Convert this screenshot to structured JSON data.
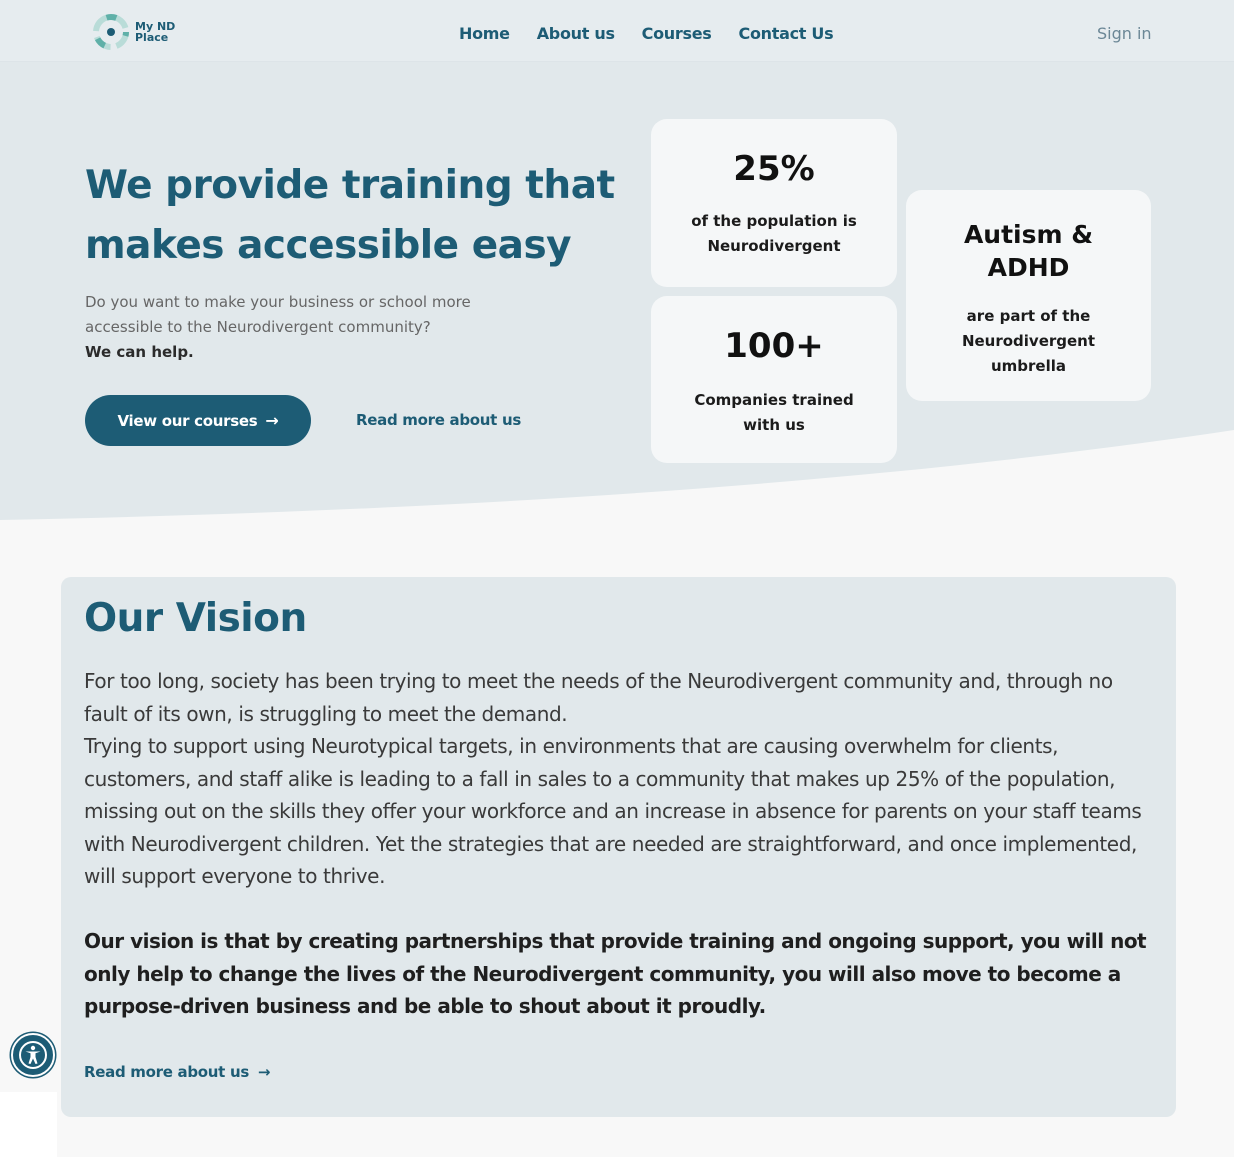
{
  "header": {
    "logo_line1": "My ND",
    "logo_line2": "Place",
    "nav": [
      "Home",
      "About us",
      "Courses",
      "Contact Us"
    ],
    "signin": "Sign in"
  },
  "hero": {
    "title_line1": "We provide training that",
    "title_line2": "makes accessible easy",
    "desc_line1": "Do you want to make your business or school more",
    "desc_line2": "accessible to the Neurodivergent community?",
    "desc_bold": "We can help.",
    "cta_label": "View our courses",
    "link_label": "Read more about us"
  },
  "stats": [
    {
      "value": "25%",
      "line1": "of the population is",
      "line2": "Neurodivergent"
    },
    {
      "value": "100+",
      "line1": "Companies trained",
      "line2": "with us"
    },
    {
      "value_line1": "Autism &",
      "value_line2": "ADHD",
      "line1": "are part of the",
      "line2": "Neurodivergent",
      "line3": "umbrella"
    }
  ],
  "vision": {
    "title": "Our Vision",
    "para1": "For too long, society has been trying to meet the needs of the Neurodivergent community and, through no fault of its own, is struggling to meet the demand.",
    "para2": "Trying to support using Neurotypical targets, in environments that are causing overwhelm for clients, customers, and staff alike is leading to a fall in sales to a community that makes up 25% of the population, missing out on the skills they offer your workforce and an increase in absence for parents on your staff teams with Neurodivergent children. Yet the strategies that are needed are straightforward, and once implemented, will support everyone to thrive.",
    "bold": "Our vision is that by creating partnerships that provide training and ongoing support, you will not only help to change the lives of the Neurodivergent community, you will also move to become a purpose-driven business and be able to shout about it proudly.",
    "link_label": "Read more about us"
  },
  "icons": {
    "logo": "logo-icon",
    "arrow": "arrow-right-icon",
    "accessibility": "accessibility-icon"
  },
  "colors": {
    "brand": "#1d5c75",
    "hero_bg": "#e1e8eb",
    "card_bg": "#f5f7f8"
  }
}
